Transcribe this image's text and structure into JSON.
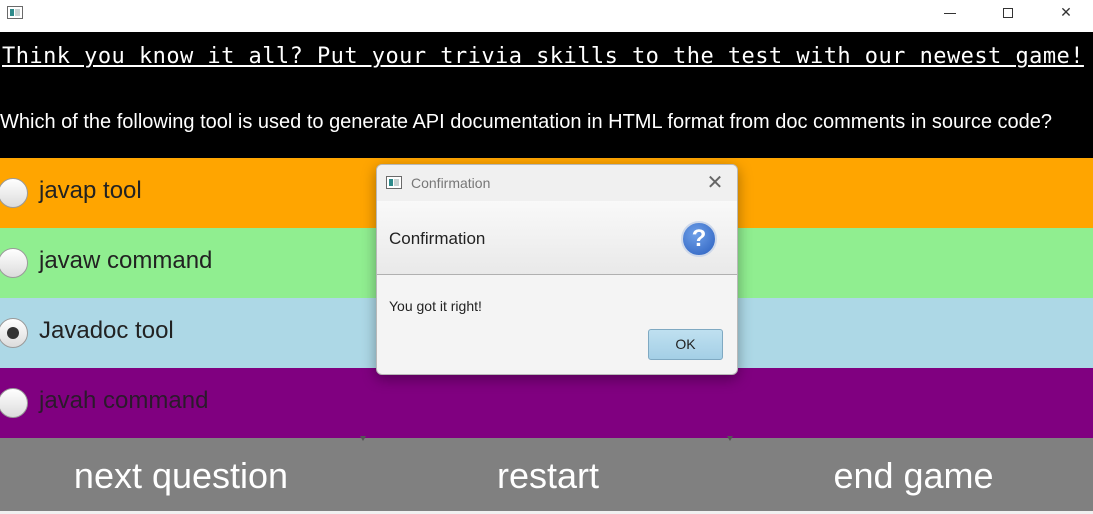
{
  "window": {
    "minimize_glyph": "",
    "close_glyph": "✕"
  },
  "header": {
    "tagline": "Think you know it all? Put your trivia skills to the test with our newest game!",
    "question": "Which of the following tool is used to generate API documentation in HTML format from doc comments in source code?"
  },
  "options": [
    {
      "label": "javap tool",
      "color": "#ffa500",
      "selected": false
    },
    {
      "label": "javaw command",
      "color": "#90ee90",
      "selected": false
    },
    {
      "label": "Javadoc tool",
      "color": "#add8e6",
      "selected": true
    },
    {
      "label": "javah command",
      "color": "#800080",
      "selected": false
    }
  ],
  "buttons": {
    "next": "next question",
    "restart": "restart",
    "end": "end game"
  },
  "dialog": {
    "title": "Confirmation",
    "close_glyph": "✕",
    "header": "Confirmation",
    "icon_glyph": "?",
    "message": "You got it right!",
    "ok": "OK"
  },
  "icons": {
    "app": "app-window-icon",
    "dialog_type": "question-icon"
  }
}
